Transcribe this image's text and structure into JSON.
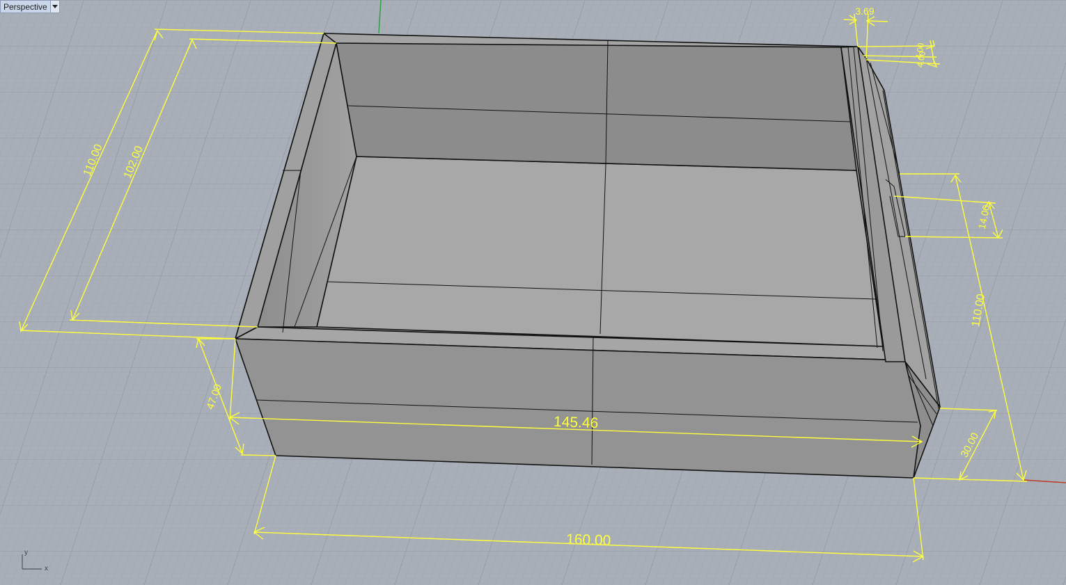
{
  "viewport": {
    "name": "Perspective",
    "dropdown_icon": "chevron-down-icon"
  },
  "dimensions": {
    "overall_length": "160.00",
    "inner_length": "145.46",
    "outer_depth": "110.00",
    "inner_depth": "102.00",
    "height": "47.00",
    "right_depth": "110.00",
    "slot_height": "14.00",
    "lower_height": "30.00",
    "wall_thickness": "3.69",
    "rim_a": "4.00",
    "rim_b": "4.00"
  },
  "axes": {
    "y_label": "y",
    "x_label": "x"
  },
  "colors": {
    "background": "#a9afb8",
    "grid_minor": "#9ea4ad",
    "grid_major": "#8d939c",
    "dimension": "#ffff3c",
    "x_axis": "#c0392b",
    "y_axis": "#2ea043"
  }
}
